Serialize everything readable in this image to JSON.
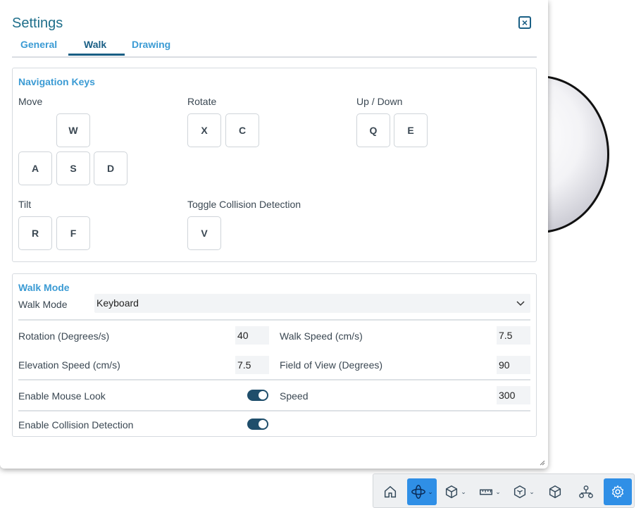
{
  "dialog": {
    "title": "Settings",
    "tabs": [
      {
        "label": "General"
      },
      {
        "label": "Walk"
      },
      {
        "label": "Drawing"
      }
    ]
  },
  "navigation": {
    "title": "Navigation Keys",
    "move_label": "Move",
    "rotate_label": "Rotate",
    "updown_label": "Up / Down",
    "tilt_label": "Tilt",
    "collision_label": "Toggle Collision Detection",
    "keys": {
      "forward": "W",
      "left": "A",
      "back": "S",
      "right": "D",
      "rotate_left": "X",
      "rotate_right": "C",
      "up": "Q",
      "down": "E",
      "tilt_up": "R",
      "tilt_down": "F",
      "collision": "V"
    }
  },
  "walk_mode": {
    "title": "Walk Mode",
    "mode_label": "Walk Mode",
    "mode_value": "Keyboard",
    "rotation_label": "Rotation (Degrees/s)",
    "rotation_value": "40",
    "walk_speed_label": "Walk Speed (cm/s)",
    "walk_speed_value": "7.5",
    "elevation_label": "Elevation Speed (cm/s)",
    "elevation_value": "7.5",
    "fov_label": "Field of View (Degrees)",
    "fov_value": "90",
    "mouse_look_label": "Enable Mouse Look",
    "mouse_look_on": true,
    "speed_label": "Speed",
    "speed_value": "300",
    "collision_label": "Enable Collision Detection",
    "collision_on": true
  },
  "toolbar": {
    "items": [
      "home-icon",
      "orbit-icon",
      "cube-icon",
      "measure-icon",
      "section-box-icon",
      "model-icon",
      "tree-icon",
      "settings-icon"
    ]
  },
  "colors": {
    "accent": "#1a5f85",
    "tab_link": "#3b9bd4",
    "active_tool": "#2f8fe6"
  }
}
